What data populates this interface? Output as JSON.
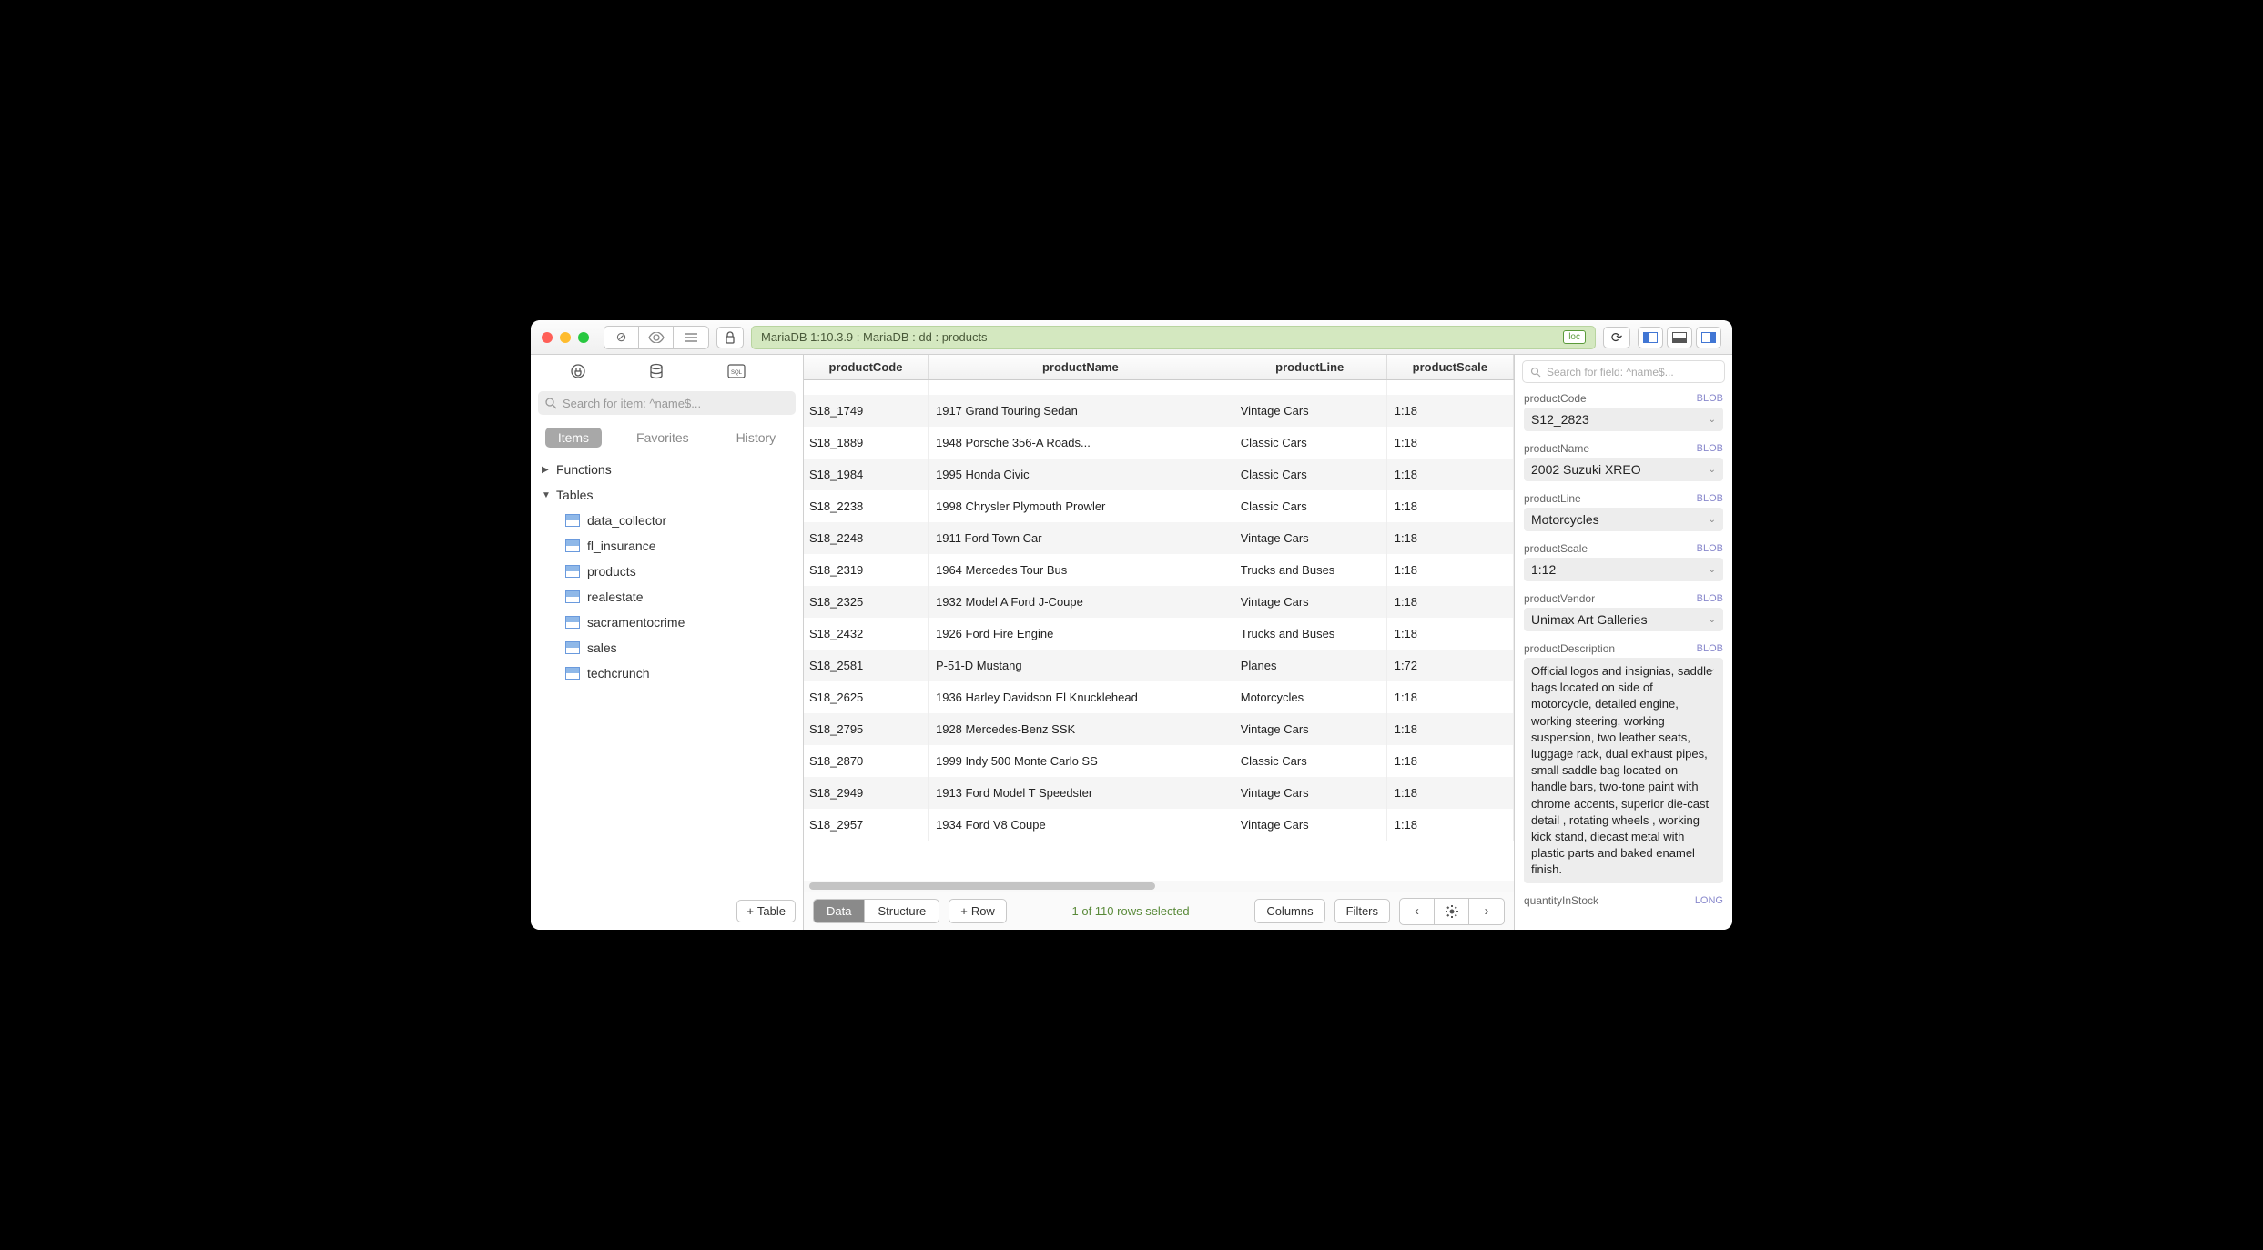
{
  "breadcrumb": "MariaDB 1:10.3.9 : MariaDB : dd : products",
  "loc_badge": "loc",
  "sidebar": {
    "search_placeholder": "Search for item: ^name$...",
    "tabs": {
      "items": "Items",
      "favorites": "Favorites",
      "history": "History"
    },
    "sections": {
      "functions": "Functions",
      "tables": "Tables"
    },
    "tables": [
      "data_collector",
      "fl_insurance",
      "products",
      "realestate",
      "sacramentocrime",
      "sales",
      "techcrunch"
    ],
    "add_table": "Table"
  },
  "columns": [
    "productCode",
    "productName",
    "productLine",
    "productScale"
  ],
  "rows": [
    {
      "productCode": "",
      "productName": "",
      "productLine": "",
      "productScale": ""
    },
    {
      "productCode": "S18_1749",
      "productName": "1917 Grand Touring Sedan",
      "productLine": "Vintage Cars",
      "productScale": "1:18"
    },
    {
      "productCode": "S18_1889",
      "productName": "1948 Porsche 356-A Roads...",
      "productLine": "Classic Cars",
      "productScale": "1:18"
    },
    {
      "productCode": "S18_1984",
      "productName": "1995 Honda Civic",
      "productLine": "Classic Cars",
      "productScale": "1:18"
    },
    {
      "productCode": "S18_2238",
      "productName": "1998 Chrysler Plymouth Prowler",
      "productLine": "Classic Cars",
      "productScale": "1:18"
    },
    {
      "productCode": "S18_2248",
      "productName": "1911 Ford Town Car",
      "productLine": "Vintage Cars",
      "productScale": "1:18"
    },
    {
      "productCode": "S18_2319",
      "productName": "1964 Mercedes Tour Bus",
      "productLine": "Trucks and Buses",
      "productScale": "1:18"
    },
    {
      "productCode": "S18_2325",
      "productName": "1932 Model A Ford J-Coupe",
      "productLine": "Vintage Cars",
      "productScale": "1:18"
    },
    {
      "productCode": "S18_2432",
      "productName": "1926 Ford Fire Engine",
      "productLine": "Trucks and Buses",
      "productScale": "1:18"
    },
    {
      "productCode": "S18_2581",
      "productName": "P-51-D Mustang",
      "productLine": "Planes",
      "productScale": "1:72"
    },
    {
      "productCode": "S18_2625",
      "productName": "1936 Harley Davidson El Knucklehead",
      "productLine": "Motorcycles",
      "productScale": "1:18"
    },
    {
      "productCode": "S18_2795",
      "productName": "1928 Mercedes-Benz SSK",
      "productLine": "Vintage Cars",
      "productScale": "1:18"
    },
    {
      "productCode": "S18_2870",
      "productName": "1999 Indy 500 Monte Carlo SS",
      "productLine": "Classic Cars",
      "productScale": "1:18"
    },
    {
      "productCode": "S18_2949",
      "productName": "1913 Ford Model T Speedster",
      "productLine": "Vintage Cars",
      "productScale": "1:18"
    },
    {
      "productCode": "S18_2957",
      "productName": "1934 Ford V8 Coupe",
      "productLine": "Vintage Cars",
      "productScale": "1:18"
    }
  ],
  "footer": {
    "data": "Data",
    "structure": "Structure",
    "row": "Row",
    "status": "1 of 110 rows selected",
    "columns": "Columns",
    "filters": "Filters"
  },
  "inspector": {
    "search_placeholder": "Search for field: ^name$...",
    "fields": [
      {
        "name": "productCode",
        "type": "BLOB",
        "value": "S12_2823"
      },
      {
        "name": "productName",
        "type": "BLOB",
        "value": "2002 Suzuki XREO"
      },
      {
        "name": "productLine",
        "type": "BLOB",
        "value": "Motorcycles"
      },
      {
        "name": "productScale",
        "type": "BLOB",
        "value": "1:12"
      },
      {
        "name": "productVendor",
        "type": "BLOB",
        "value": "Unimax Art Galleries"
      },
      {
        "name": "productDescription",
        "type": "BLOB",
        "value": "Official logos and insignias, saddle bags located on side of motorcycle, detailed engine, working steering, working suspension, two leather seats, luggage rack, dual exhaust pipes, small saddle bag located on handle bars, two-tone paint with chrome accents, superior die-cast detail , rotating wheels , working kick stand, diecast metal with plastic parts and baked enamel finish."
      },
      {
        "name": "quantityInStock",
        "type": "LONG",
        "value": ""
      }
    ]
  }
}
